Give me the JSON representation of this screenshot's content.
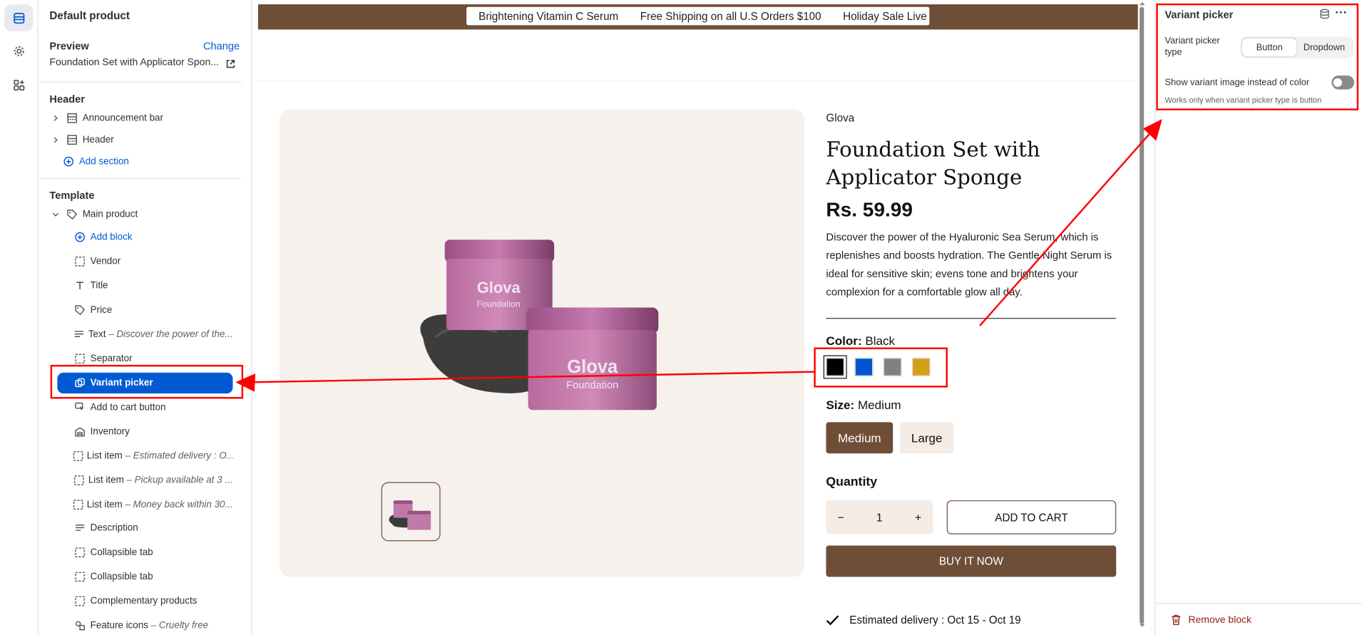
{
  "sidebar": {
    "title": "Default product",
    "preview_label": "Preview",
    "change_label": "Change",
    "preview_value": "Foundation Set with Applicator Spon...",
    "header_group": "Header",
    "header_items": [
      "Announcement bar",
      "Header"
    ],
    "add_section": "Add section",
    "template_group": "Template",
    "main_product": "Main product",
    "add_block": "Add block",
    "blocks": [
      {
        "label": "Vendor",
        "detail": ""
      },
      {
        "label": "Title",
        "detail": ""
      },
      {
        "label": "Price",
        "detail": ""
      },
      {
        "label": "Text",
        "detail": "– Discover the power of the..."
      },
      {
        "label": "Separator",
        "detail": ""
      },
      {
        "label": "Variant picker",
        "detail": ""
      },
      {
        "label": "Add to cart button",
        "detail": ""
      },
      {
        "label": "Inventory",
        "detail": ""
      },
      {
        "label": "List item",
        "detail": "– Estimated delivery : O..."
      },
      {
        "label": "List item",
        "detail": "– Pickup available at 3 ..."
      },
      {
        "label": "List item",
        "detail": "– Money back within 30..."
      },
      {
        "label": "Description",
        "detail": ""
      },
      {
        "label": "Collapsible tab",
        "detail": ""
      },
      {
        "label": "Collapsible tab",
        "detail": ""
      },
      {
        "label": "Complementary products",
        "detail": ""
      },
      {
        "label": "Feature icons",
        "detail": "– Cruelty free"
      }
    ]
  },
  "announcement": [
    "Brightening Vitamin C Serum",
    "Free Shipping on all U.S Orders $100",
    "Holiday Sale Live N"
  ],
  "product": {
    "vendor": "Glova",
    "title": "Foundation Set with Applicator Sponge",
    "price": "Rs. 59.99",
    "description": "Discover the power of the Hyaluronic Sea Serum, which is replenishes and boosts hydration. The Gentle Night Serum is ideal for sensitive skin; evens tone and brightens your complexion for a comfortable glow all day.",
    "jar_brand": "Glova",
    "jar_sub": "Foundation",
    "color_label": "Color:",
    "color_value": "Black",
    "colors": [
      "#000000",
      "#0055cc",
      "#808080",
      "#d4a017"
    ],
    "size_label": "Size:",
    "size_value": "Medium",
    "sizes": [
      "Medium",
      "Large"
    ],
    "quantity_label": "Quantity",
    "quantity": "1",
    "minus": "−",
    "plus": "+",
    "add_to_cart": "ADD TO CART",
    "buy_now": "BUY IT NOW",
    "delivery": "Estimated delivery : Oct 15 - Oct 19"
  },
  "settings": {
    "title": "Variant picker",
    "more": "···",
    "type_label": "Variant picker type",
    "type_options": [
      "Button",
      "Dropdown"
    ],
    "selected_type": "Button",
    "toggle_label": "Show variant image instead of color",
    "toggle_on": false,
    "help": "Works only when variant picker type is button",
    "remove": "Remove block"
  },
  "colors": {
    "accent": "#005bd3",
    "brand_brown": "#6f4e37",
    "annotation_red": "#ff0000",
    "danger": "#8e1f0b"
  }
}
